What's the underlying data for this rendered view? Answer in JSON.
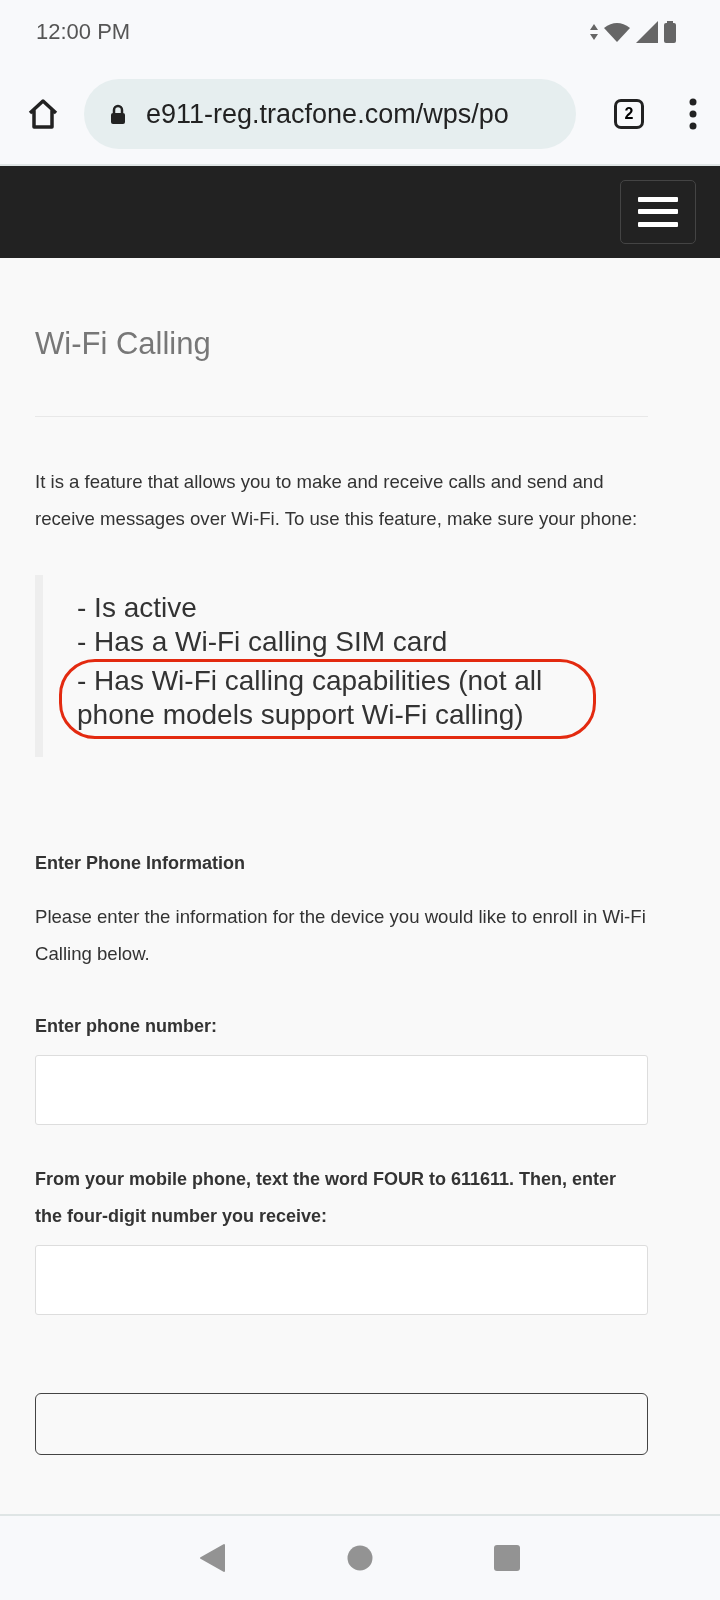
{
  "status_bar": {
    "time": "12:00 PM"
  },
  "browser": {
    "url": "e911-reg.tracfone.com/wps/po",
    "tab_count": "2"
  },
  "page": {
    "title": "Wi-Fi Calling",
    "intro": "It is a feature that allows you to make and receive calls and send and receive messages over Wi-Fi. To use this feature, make sure your phone:",
    "requirements": [
      {
        "text": "- Is active",
        "highlighted": false
      },
      {
        "text": "- Has a Wi-Fi calling SIM card",
        "highlighted": false
      },
      {
        "text": "- Has Wi-Fi calling capabilities (not all phone models support Wi-Fi calling)",
        "highlighted": true
      }
    ],
    "section_heading": "Enter Phone Information",
    "section_text": "Please enter the information for the device you would like to enroll in Wi-Fi Calling below.",
    "fields": [
      {
        "label": "Enter phone number:"
      },
      {
        "label": "From your mobile phone, text the word FOUR to 611611. Then, enter the four-digit number you receive:"
      }
    ]
  }
}
